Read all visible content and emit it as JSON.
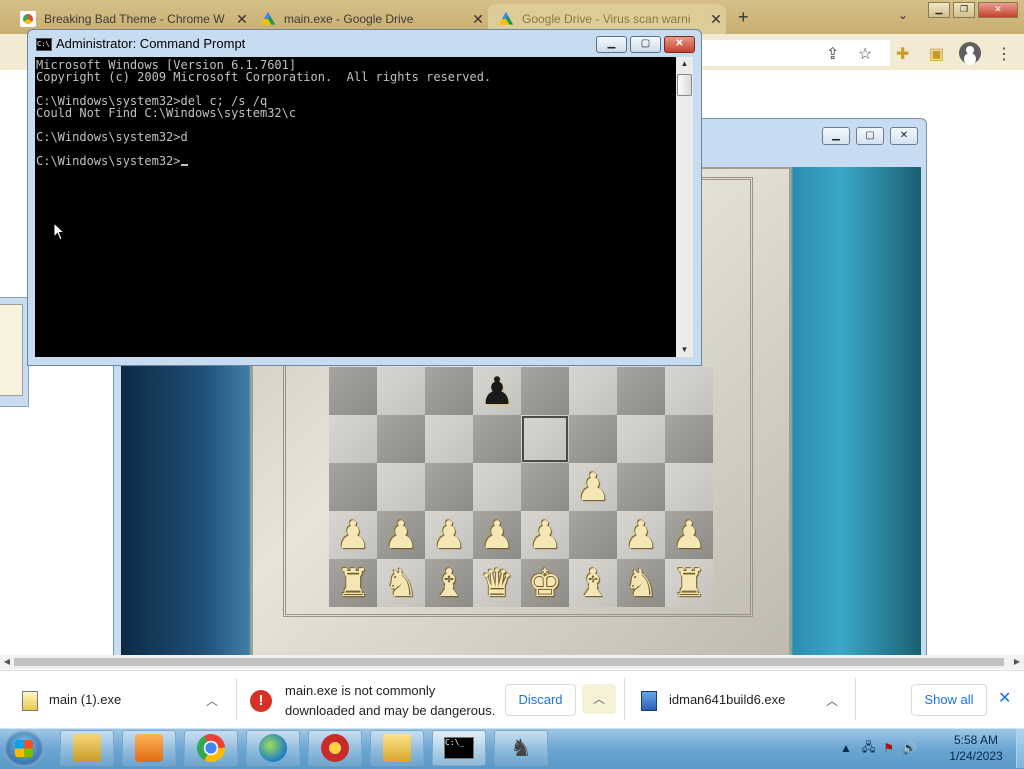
{
  "browser": {
    "tabs": [
      {
        "title": "Breaking Bad Theme - Chrome W",
        "active": false
      },
      {
        "title": "main.exe - Google Drive",
        "active": false
      },
      {
        "title": "Google Drive - Virus scan warni",
        "active": true
      }
    ],
    "new_tab_label": "+",
    "tab_close_glyph": "✕",
    "tab_search_glyph": "⌄"
  },
  "cmd": {
    "title": "Administrator: Command Prompt",
    "lines": [
      "Microsoft Windows [Version 6.1.7601]",
      "Copyright (c) 2009 Microsoft Corporation.  All rights reserved.",
      "",
      "C:\\Windows\\system32>del c; /s /q",
      "Could Not Find C:\\Windows\\system32\\c",
      "",
      "C:\\Windows\\system32>d",
      "",
      "C:\\Windows\\system32>"
    ]
  },
  "chess": {
    "ranks": [
      [
        "",
        "",
        "",
        "black-pawn",
        "",
        "",
        "",
        ""
      ],
      [
        "",
        "",
        "",
        "",
        "",
        "",
        "",
        ""
      ],
      [
        "",
        "",
        "",
        "",
        "",
        "white-pawn",
        "",
        ""
      ],
      [
        "white-pawn",
        "white-pawn",
        "white-pawn",
        "white-pawn",
        "white-pawn",
        "",
        "white-pawn",
        "white-pawn"
      ],
      [
        "white-rook",
        "white-knight",
        "white-bishop",
        "white-queen",
        "white-king",
        "white-bishop",
        "white-knight",
        "white-rook"
      ]
    ],
    "selected_square": [
      1,
      4
    ]
  },
  "downloads": {
    "items": [
      {
        "name": "main (1).exe"
      },
      {
        "warning_line1": "main.exe is not commonly",
        "warning_line2": "downloaded and may be dangerous.",
        "discard_label": "Discard"
      },
      {
        "name": "idman641build6.exe"
      }
    ],
    "show_all_label": "Show all"
  },
  "taskbar": {
    "apps": [
      "explorer-icon",
      "media-player-icon",
      "chrome-icon",
      "idm-icon",
      "pinball-icon",
      "folder-app-icon",
      "cmd-icon",
      "chess-icon"
    ],
    "time": "5:58 AM",
    "date": "1/24/2023"
  },
  "colors": {
    "accent": "#1a73e8",
    "danger": "#d93025"
  }
}
